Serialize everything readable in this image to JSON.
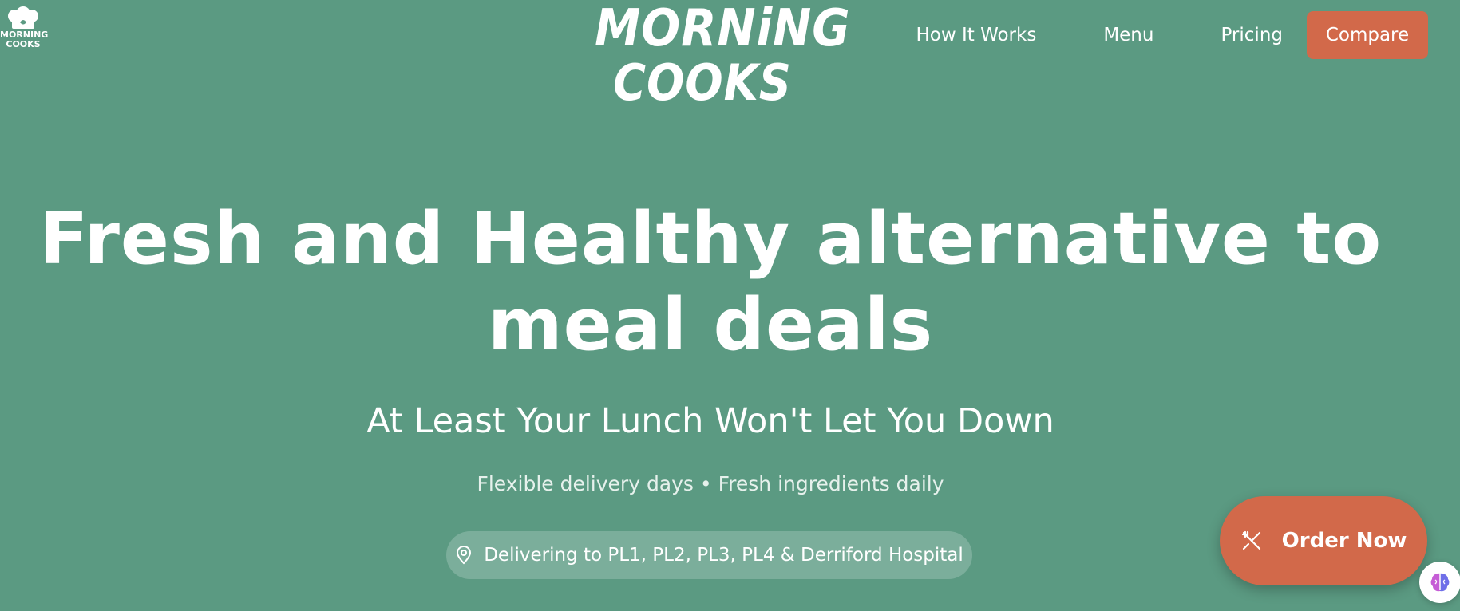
{
  "colors": {
    "background": "#5b9a82",
    "accent": "#d2694a",
    "text": "#ffffff"
  },
  "corner_logo": {
    "line1": "MORNING",
    "line2": "COOKS",
    "icon": "chef-hat-icon"
  },
  "brand": {
    "line1": "MORNiNG",
    "line2": "COOKS"
  },
  "nav": {
    "items": [
      {
        "label": "How It Works"
      },
      {
        "label": "Menu"
      },
      {
        "label": "Pricing"
      }
    ],
    "compare_label": "Compare"
  },
  "hero": {
    "title_line1": "Fresh and Healthy alternative to",
    "title_line2": "meal deals",
    "subtitle": "At Least Your Lunch Won't Let You Down",
    "features": "Flexible delivery days • Fresh ingredients daily",
    "delivery_text": "Delivering to PL1, PL2, PL3, PL4 & Derriford Hospital",
    "delivery_icon": "map-pin-icon"
  },
  "order": {
    "label": "Order Now",
    "icon": "utensils-crossed-icon"
  },
  "widget": {
    "icon": "brain-icon"
  }
}
